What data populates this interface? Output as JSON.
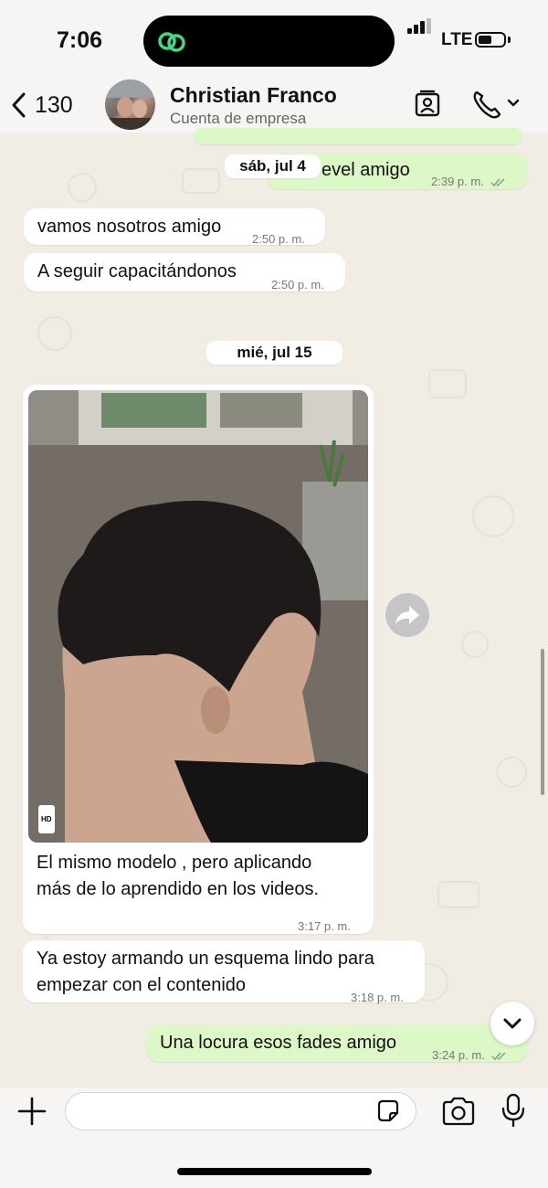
{
  "status_bar": {
    "time": "7:06",
    "network": "LTE",
    "battery_level": 0.55,
    "signal_bars": 3
  },
  "header": {
    "back_count": "130",
    "contact_name": "Christian Franco",
    "contact_subtitle": "Cuenta de empresa"
  },
  "messages": [
    {
      "direction": "outgoing",
      "text": "evel amigo",
      "time": "2:39 p. m.",
      "read": true
    },
    {
      "direction": "incoming",
      "text": "vamos nosotros amigo",
      "time": "2:50 p. m."
    },
    {
      "direction": "incoming",
      "text": "A seguir capacitándonos",
      "time": "2:50 p. m."
    },
    {
      "direction": "incoming",
      "type": "image",
      "badge": "HD",
      "caption_line1": "El mismo modelo , pero aplicando",
      "caption_line2": "más de lo aprendido en los videos.",
      "time": "3:17 p. m."
    },
    {
      "direction": "incoming",
      "text_line1": "Ya estoy armando un esquema lindo para",
      "text_line2": "empezar con el contenido",
      "time": "3:18 p. m."
    },
    {
      "direction": "outgoing",
      "text": "Una locura esos fades amigo",
      "time": "3:24 p. m.",
      "read": true
    }
  ],
  "date_separators": [
    "sáb, jul 4",
    "mié, jul 15"
  ],
  "input": {
    "value": "",
    "placeholder": ""
  },
  "colors": {
    "incoming_bubble": "#ffffff",
    "outgoing_bubble": "#dcf8c6",
    "read_ticks": "#8a9a8a",
    "island_icon": "#3ddc84",
    "wallpaper": "#f1ece4"
  },
  "icons": [
    "back-chevron",
    "contact-card",
    "phone",
    "chevron-down",
    "share-forward",
    "plus",
    "sticker",
    "camera",
    "microphone",
    "double-check"
  ]
}
